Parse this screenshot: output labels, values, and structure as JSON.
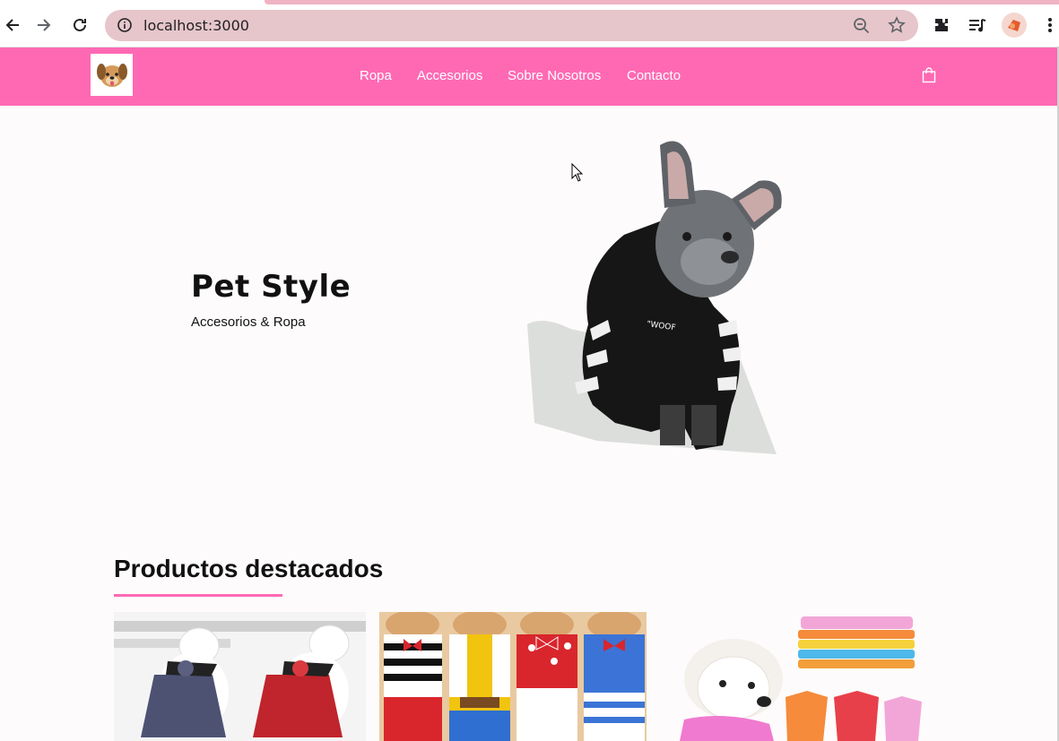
{
  "browser": {
    "url": "localhost:3000",
    "icons": [
      "back-icon",
      "forward-icon",
      "reload-icon",
      "site-info-icon",
      "zoom-out-icon",
      "bookmark-star-icon",
      "extensions-icon",
      "media-queue-icon",
      "profile-avatar",
      "more-menu-icon"
    ]
  },
  "header": {
    "logo_icon": "dog-face-logo",
    "nav": [
      "Ropa",
      "Accesorios",
      "Sobre Nosotros",
      "Contacto"
    ],
    "cart_icon": "shopping-bag-icon",
    "colors": {
      "bar": "#ff69b4",
      "text": "#ffffff"
    }
  },
  "hero": {
    "title": "Pet Style",
    "subtitle": "Accesorios & Ropa",
    "image": "french-bulldog-in-black-hoodie",
    "hoodie_text": "\"WOOF"
  },
  "featured": {
    "title": "Productos destacados",
    "accent": "#ff69b4",
    "products": [
      {
        "image": "white-dog-plaid-dresses"
      },
      {
        "image": "puppy-costume-shirts"
      },
      {
        "image": "poodle-with-colorful-shirts"
      }
    ]
  }
}
